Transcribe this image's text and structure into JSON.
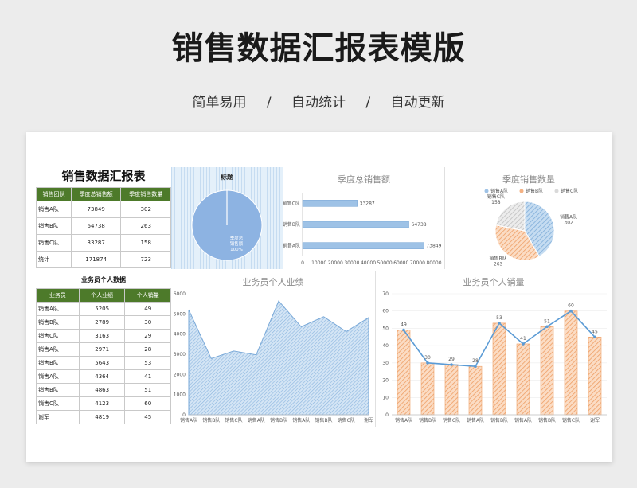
{
  "page": {
    "title": "销售数据汇报表模版",
    "tags": [
      "简单易用",
      "自动统计",
      "自动更新"
    ],
    "sep": "/"
  },
  "summary_table": {
    "title": "销售数据汇报表",
    "headers": [
      "销售团队",
      "季度总销售额",
      "季度销售数量"
    ],
    "rows": [
      [
        "销售A队",
        "73849",
        "302"
      ],
      [
        "销售B队",
        "64738",
        "263"
      ],
      [
        "销售C队",
        "33287",
        "158"
      ],
      [
        "统计",
        "171874",
        "723"
      ]
    ]
  },
  "person_table": {
    "title": "业务员个人数据",
    "headers": [
      "业务员",
      "个人业绩",
      "个人销量"
    ],
    "rows": [
      [
        "销售A队",
        "5205",
        "49"
      ],
      [
        "销售B队",
        "2789",
        "30"
      ],
      [
        "销售C队",
        "3163",
        "29"
      ],
      [
        "销售A队",
        "2971",
        "28"
      ],
      [
        "销售B队",
        "5643",
        "53"
      ],
      [
        "销售A队",
        "4364",
        "41"
      ],
      [
        "销售B队",
        "4863",
        "51"
      ],
      [
        "销售C队",
        "4123",
        "60"
      ],
      [
        "谢军",
        "4819",
        "45"
      ]
    ]
  },
  "chart_data": [
    {
      "type": "pie",
      "title": "标题",
      "labels": [
        "季度总销售额"
      ],
      "values": [
        100
      ],
      "data_labels": [
        "季度总",
        "销售额",
        "100%"
      ],
      "colors": [
        "#8db3e2"
      ]
    },
    {
      "type": "bar",
      "orientation": "horizontal",
      "title": "季度总销售额",
      "categories": [
        "销售C队",
        "销售B队",
        "销售A队"
      ],
      "values": [
        33287,
        64738,
        73849
      ],
      "xlim": [
        0,
        80000
      ],
      "xticks": [
        "0",
        "10000",
        "20000",
        "30000",
        "40000",
        "50000",
        "60000",
        "70000",
        "80000"
      ],
      "colors": [
        "#9ec2e6"
      ]
    },
    {
      "type": "pie",
      "title": "季度销售数量",
      "labels": [
        "销售A队",
        "销售B队",
        "销售C队"
      ],
      "values": [
        302,
        263,
        158
      ],
      "legend": "top",
      "colors": [
        "#9ec2e6",
        "#f4b183",
        "#d9d9d9"
      ]
    },
    {
      "type": "area",
      "title": "业务员个人业绩",
      "categories": [
        "销售A队",
        "销售B队",
        "销售C队",
        "销售A队",
        "销售B队",
        "销售A队",
        "销售B队",
        "销售C队",
        "谢军"
      ],
      "values": [
        5205,
        2789,
        3163,
        2971,
        5643,
        4364,
        4863,
        4123,
        4819
      ],
      "ylim": [
        0,
        6000
      ],
      "yticks": [
        "0",
        "1000",
        "2000",
        "3000",
        "4000",
        "5000",
        "6000"
      ],
      "colors": [
        "#9ec2e6"
      ]
    },
    {
      "type": "bar",
      "title": "业务员个人销量",
      "categories": [
        "销售A队",
        "销售B队",
        "销售C队",
        "销售A队",
        "销售B队",
        "销售A队",
        "销售B队",
        "销售C队",
        "谢军"
      ],
      "values": [
        49,
        30,
        29,
        28,
        53,
        41,
        51,
        60,
        45
      ],
      "line_overlay": true,
      "ylim": [
        0,
        70
      ],
      "yticks": [
        "0",
        "10",
        "20",
        "30",
        "40",
        "50",
        "60",
        "70"
      ],
      "colors": [
        "#f4b183",
        "#5b9bd5"
      ]
    }
  ]
}
